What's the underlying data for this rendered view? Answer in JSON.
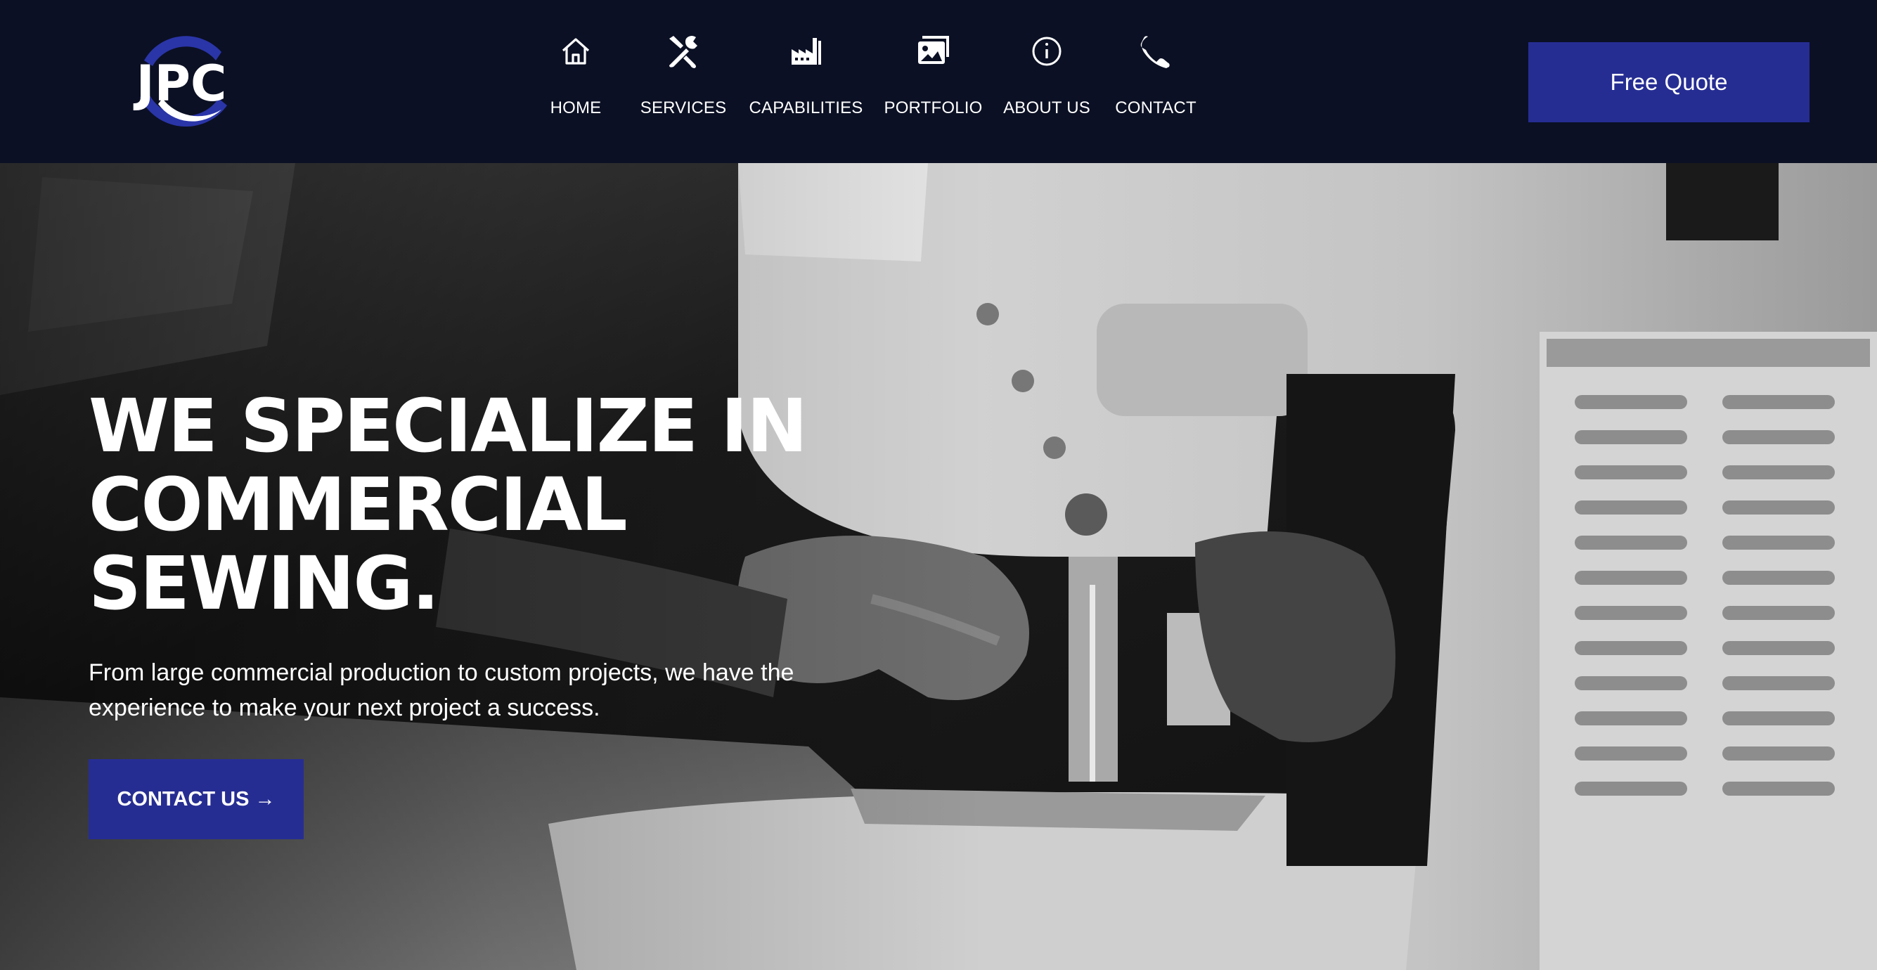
{
  "brand": {
    "logo_text": "JPC",
    "logo_color": "#2a35a8"
  },
  "nav": {
    "items": [
      {
        "label": "HOME",
        "icon": "home-icon"
      },
      {
        "label": "SERVICES",
        "icon": "tools-icon"
      },
      {
        "label": "CAPABILITIES",
        "icon": "factory-icon"
      },
      {
        "label": "PORTFOLIO",
        "icon": "images-icon"
      },
      {
        "label": "ABOUT US",
        "icon": "info-icon"
      },
      {
        "label": "CONTACT",
        "icon": "phone-icon"
      }
    ]
  },
  "header": {
    "quote_label": "Free Quote"
  },
  "hero": {
    "headline": "WE SPECIALIZE IN COMMERCIAL SEWING.",
    "subtext": "From large commercial production to custom projects, we have the experience to make your next project a success.",
    "cta_label": "CONTACT US →",
    "image_subject": "sewing-machine-photo"
  },
  "colors": {
    "header_bg": "#0b1024",
    "accent": "#262d92",
    "text": "#ffffff"
  }
}
